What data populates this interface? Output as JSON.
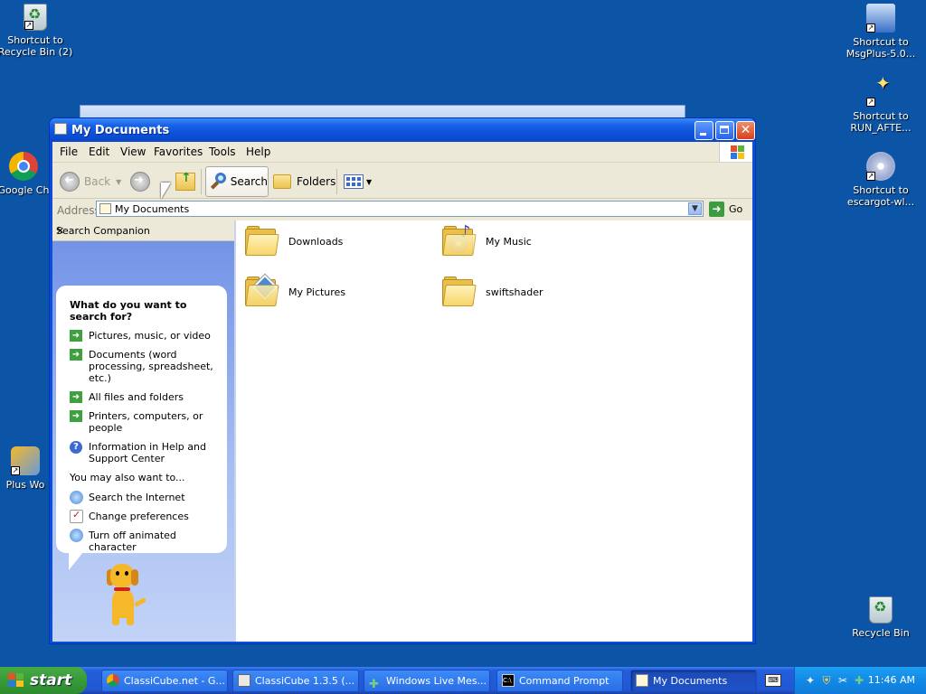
{
  "desktop": {
    "icons": [
      {
        "label": "Shortcut to Recycle Bin (2)"
      },
      {
        "label": "Google Ch"
      },
      {
        "label": "Plus Wo"
      },
      {
        "label": "Shortcut to MsgPlus-5.0..."
      },
      {
        "label": "Shortcut to RUN_AFTE..."
      },
      {
        "label": "Shortcut to escargot-wl..."
      },
      {
        "label": "Recycle Bin"
      }
    ]
  },
  "window": {
    "title": "My Documents",
    "menu": [
      "File",
      "Edit",
      "View",
      "Favorites",
      "Tools",
      "Help"
    ],
    "toolbar": {
      "back_label": "Back",
      "search_label": "Search",
      "folders_label": "Folders"
    },
    "address": {
      "label": "Address",
      "value": "My Documents",
      "go_label": "Go"
    },
    "search_companion": {
      "title": "Search Companion",
      "question": "What do you want to search for?",
      "options": [
        "Pictures, music, or video",
        "Documents (word processing, spreadsheet, etc.)",
        "All files and folders",
        "Printers, computers, or people",
        "Information in Help and Support Center"
      ],
      "also_label": "You may also want to...",
      "also_options": [
        "Search the Internet",
        "Change preferences",
        "Turn off animated character"
      ]
    },
    "files": [
      {
        "name": "Downloads",
        "icon": "folder-icon"
      },
      {
        "name": "My Music",
        "icon": "music-folder-icon"
      },
      {
        "name": "My Pictures",
        "icon": "pictures-folder-icon"
      },
      {
        "name": "swiftshader",
        "icon": "folder-icon"
      }
    ]
  },
  "taskbar": {
    "start_label": "start",
    "tasks": [
      {
        "label": "ClassiCube.net - G..."
      },
      {
        "label": "ClassiCube 1.3.5 (..."
      },
      {
        "label": "Windows Live Mes..."
      },
      {
        "label": "Command Prompt"
      },
      {
        "label": "My Documents"
      }
    ],
    "clock": "11:46 AM"
  }
}
